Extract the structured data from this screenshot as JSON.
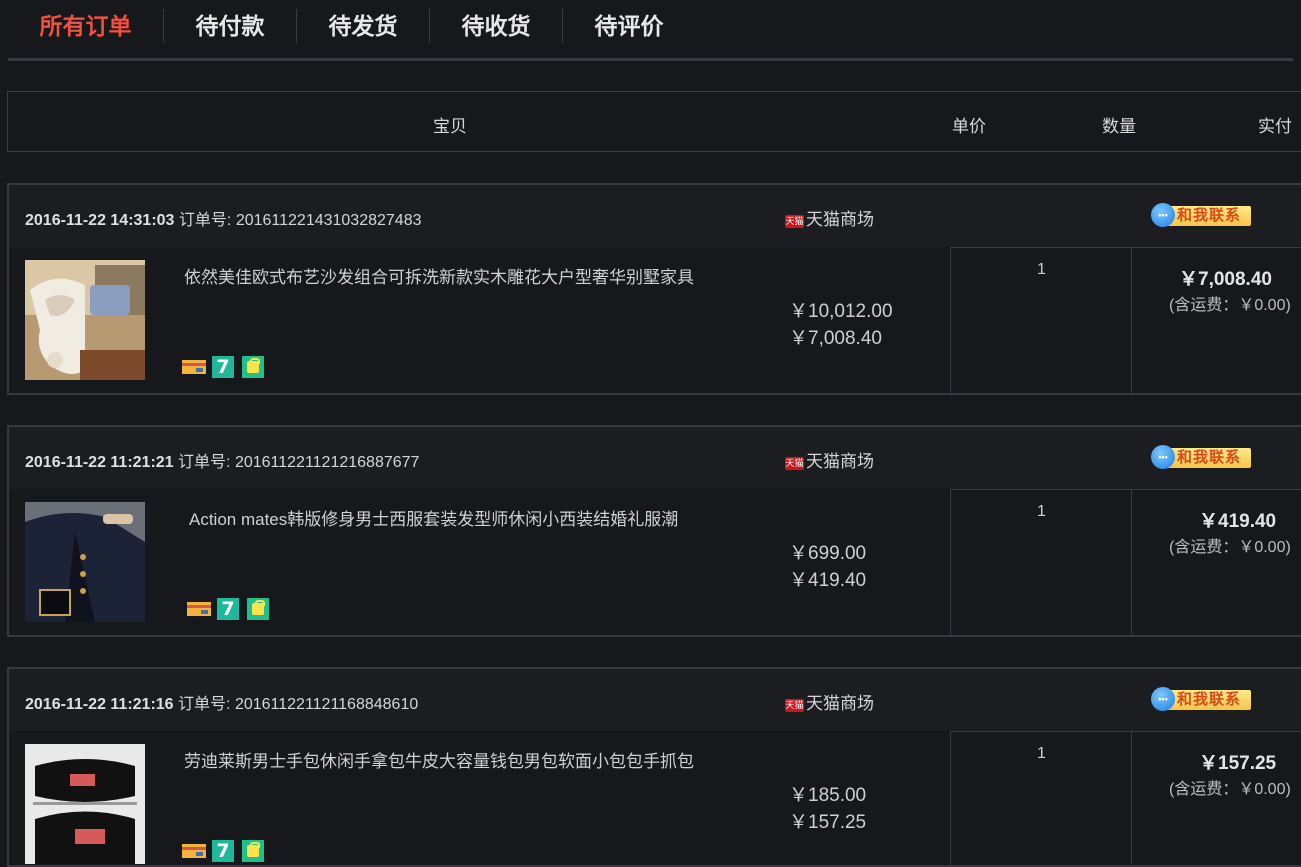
{
  "tabs": [
    {
      "label": "所有订单",
      "active": true
    },
    {
      "label": "待付款"
    },
    {
      "label": "待发货"
    },
    {
      "label": "待收货"
    },
    {
      "label": "待评价"
    }
  ],
  "columns": {
    "item": "宝贝",
    "unit_price": "单价",
    "quantity": "数量",
    "paid": "实付"
  },
  "order_no_label": "订单号:",
  "shipping_label": "(含运费：￥0.00)",
  "contact_label": "和我联系",
  "tmall_badge": "天猫",
  "orders": [
    {
      "time": "2016-11-22 14:31:03",
      "order_no": "20161122143103282748​3",
      "shop": "天猫商场",
      "title": "依然美佳欧式布艺沙发组合可拆洗新款实木雕花大户型奢华别墅家具",
      "original_price": "￥10,012.00",
      "price": "￥7,008.40",
      "quantity": "1",
      "paid": "￥7,008.40"
    },
    {
      "time": "2016-11-22 11:21:21",
      "order_no": "20161122112121688767​7",
      "shop": "天猫商场",
      "title": "Action mates韩版修身男士西服套装发型师休闲小西装结婚礼服潮",
      "original_price": "￥699.00",
      "price": "￥419.40",
      "quantity": "1",
      "paid": "￥419.40"
    },
    {
      "time": "2016-11-22 11:21:16",
      "order_no": "20161122112116884861​0",
      "shop": "天猫商场",
      "title": "劳迪莱斯男士手包休闲手拿包牛皮大容量钱包男包软面小包包手抓包",
      "original_price": "￥185.00",
      "price": "￥157.25",
      "quantity": "1",
      "paid": "￥157.25"
    }
  ],
  "icons": [
    "card-icon",
    "seven-day-return-icon",
    "shopping-bag-icon",
    "chat-bubble-icon"
  ],
  "colors": {
    "accent": "#e3342a",
    "background": "#17181c"
  }
}
